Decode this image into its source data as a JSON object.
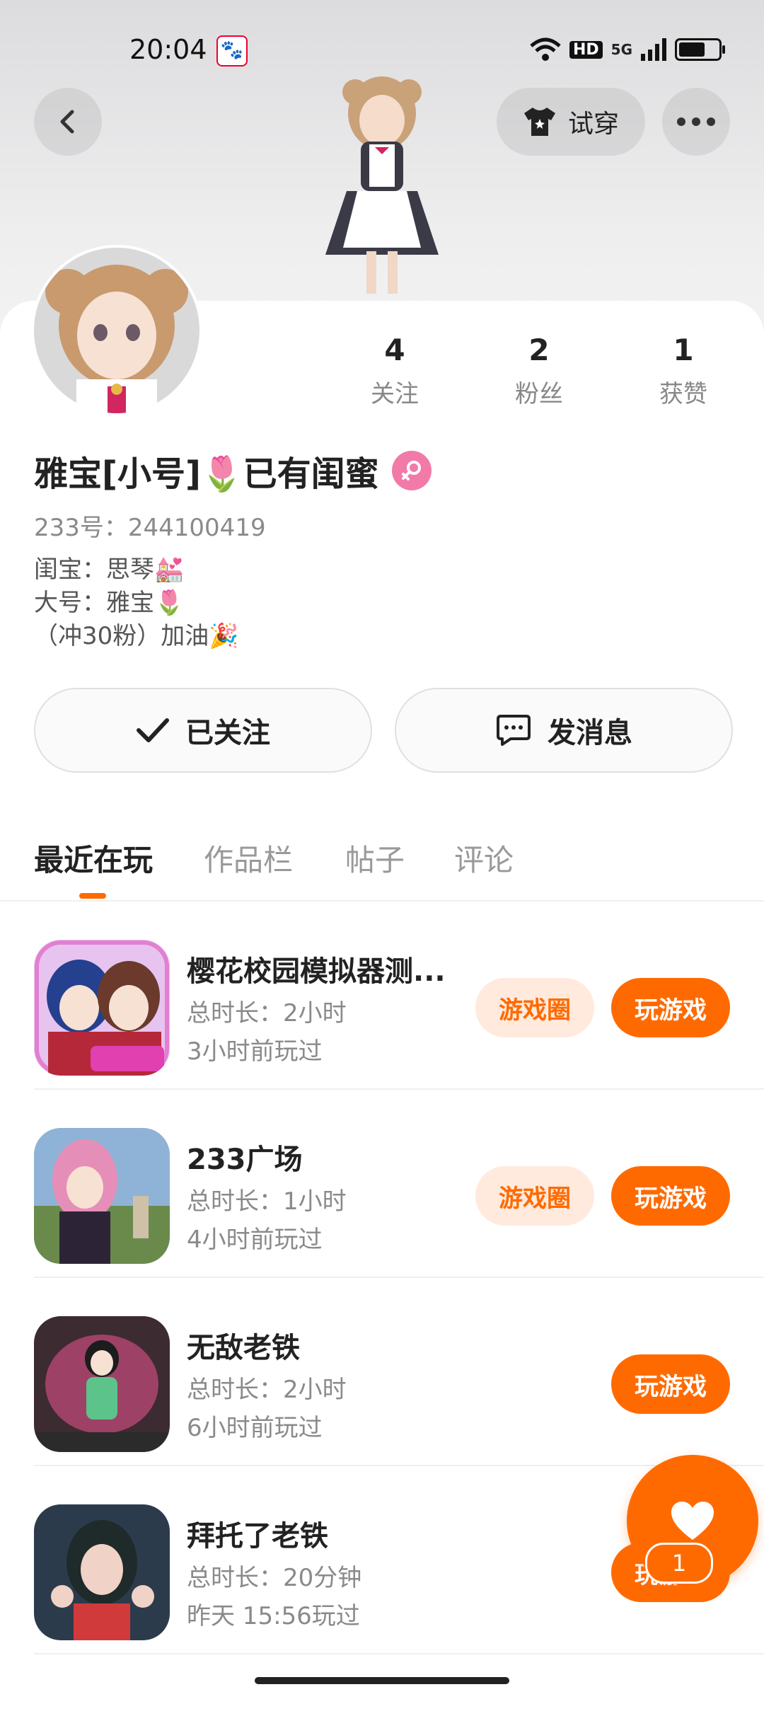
{
  "status_bar": {
    "time": "20:04",
    "network": "5G",
    "hd": "HD"
  },
  "header": {
    "try_on_label": "试穿"
  },
  "profile": {
    "stats": [
      {
        "value": "4",
        "label": "关注"
      },
      {
        "value": "2",
        "label": "粉丝"
      },
      {
        "value": "1",
        "label": "获赞"
      }
    ],
    "username": "雅宝[小号]🌷已有闺蜜",
    "uid_text": "233号：244100419",
    "bio": "闺宝：思琴💒\n大号：雅宝🌷\n（冲30粉）加油🎉"
  },
  "actions": {
    "followed_label": "已关注",
    "message_label": "发消息"
  },
  "tabs": [
    "最近在玩",
    "作品栏",
    "帖子",
    "评论"
  ],
  "games": [
    {
      "name": "樱花校园模拟器测...",
      "duration": "总时长：2小时",
      "last_played": "3小时前玩过",
      "circle_label": "游戏圈",
      "play_label": "玩游戏"
    },
    {
      "name": "233广场",
      "duration": "总时长：1小时",
      "last_played": "4小时前玩过",
      "circle_label": "游戏圈",
      "play_label": "玩游戏"
    },
    {
      "name": "无敌老铁",
      "duration": "总时长：2小时",
      "last_played": "6小时前玩过",
      "play_label": "玩游戏"
    },
    {
      "name": "拜托了老铁",
      "duration": "总时长：20分钟",
      "last_played": "昨天 15:56玩过",
      "play_label": "玩游戏"
    }
  ],
  "fab": {
    "count": "1"
  },
  "colors": {
    "accent": "#ff6a00",
    "accent_light": "#ffeadd",
    "gender": "#f27aa8"
  }
}
